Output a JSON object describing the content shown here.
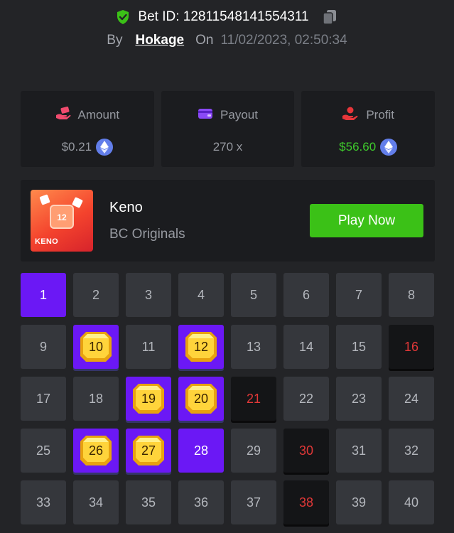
{
  "bet": {
    "id_label": "Bet ID: 12811548141554311",
    "by_label": "By",
    "user": "Hokage",
    "on_label": "On",
    "date": "11/02/2023, 02:50:34"
  },
  "stats": {
    "amount": {
      "label": "Amount",
      "value": "$0.21",
      "icon": "money-hand-icon"
    },
    "payout": {
      "label": "Payout",
      "value": "270 x",
      "icon": "wallet-icon"
    },
    "profit": {
      "label": "Profit",
      "value": "$56.60",
      "icon": "profit-hand-icon"
    }
  },
  "colors": {
    "accent_purple": "#6b18f5",
    "play_green": "#3bc117",
    "profit_green": "#3fcb2c",
    "miss_red": "#e23838",
    "eth_blue": "#627eea"
  },
  "game": {
    "name": "Keno",
    "provider": "BC Originals",
    "play_label": "Play Now",
    "thumb_number": "12",
    "thumb_title": "KENO"
  },
  "grid": {
    "columns": 8,
    "tiles": [
      {
        "n": "1",
        "state": "selected"
      },
      {
        "n": "2",
        "state": "normal"
      },
      {
        "n": "3",
        "state": "normal"
      },
      {
        "n": "4",
        "state": "normal"
      },
      {
        "n": "5",
        "state": "normal"
      },
      {
        "n": "6",
        "state": "normal"
      },
      {
        "n": "7",
        "state": "normal"
      },
      {
        "n": "8",
        "state": "normal"
      },
      {
        "n": "9",
        "state": "normal"
      },
      {
        "n": "10",
        "state": "hit"
      },
      {
        "n": "11",
        "state": "normal"
      },
      {
        "n": "12",
        "state": "hit"
      },
      {
        "n": "13",
        "state": "normal"
      },
      {
        "n": "14",
        "state": "normal"
      },
      {
        "n": "15",
        "state": "normal"
      },
      {
        "n": "16",
        "state": "miss"
      },
      {
        "n": "17",
        "state": "normal"
      },
      {
        "n": "18",
        "state": "normal"
      },
      {
        "n": "19",
        "state": "hit"
      },
      {
        "n": "20",
        "state": "hit"
      },
      {
        "n": "21",
        "state": "miss"
      },
      {
        "n": "22",
        "state": "normal"
      },
      {
        "n": "23",
        "state": "normal"
      },
      {
        "n": "24",
        "state": "normal"
      },
      {
        "n": "25",
        "state": "normal"
      },
      {
        "n": "26",
        "state": "hit"
      },
      {
        "n": "27",
        "state": "hit"
      },
      {
        "n": "28",
        "state": "selected"
      },
      {
        "n": "29",
        "state": "normal"
      },
      {
        "n": "30",
        "state": "miss"
      },
      {
        "n": "31",
        "state": "normal"
      },
      {
        "n": "32",
        "state": "normal"
      },
      {
        "n": "33",
        "state": "normal"
      },
      {
        "n": "34",
        "state": "normal"
      },
      {
        "n": "35",
        "state": "normal"
      },
      {
        "n": "36",
        "state": "normal"
      },
      {
        "n": "37",
        "state": "normal"
      },
      {
        "n": "38",
        "state": "miss"
      },
      {
        "n": "39",
        "state": "normal"
      },
      {
        "n": "40",
        "state": "normal"
      }
    ]
  }
}
